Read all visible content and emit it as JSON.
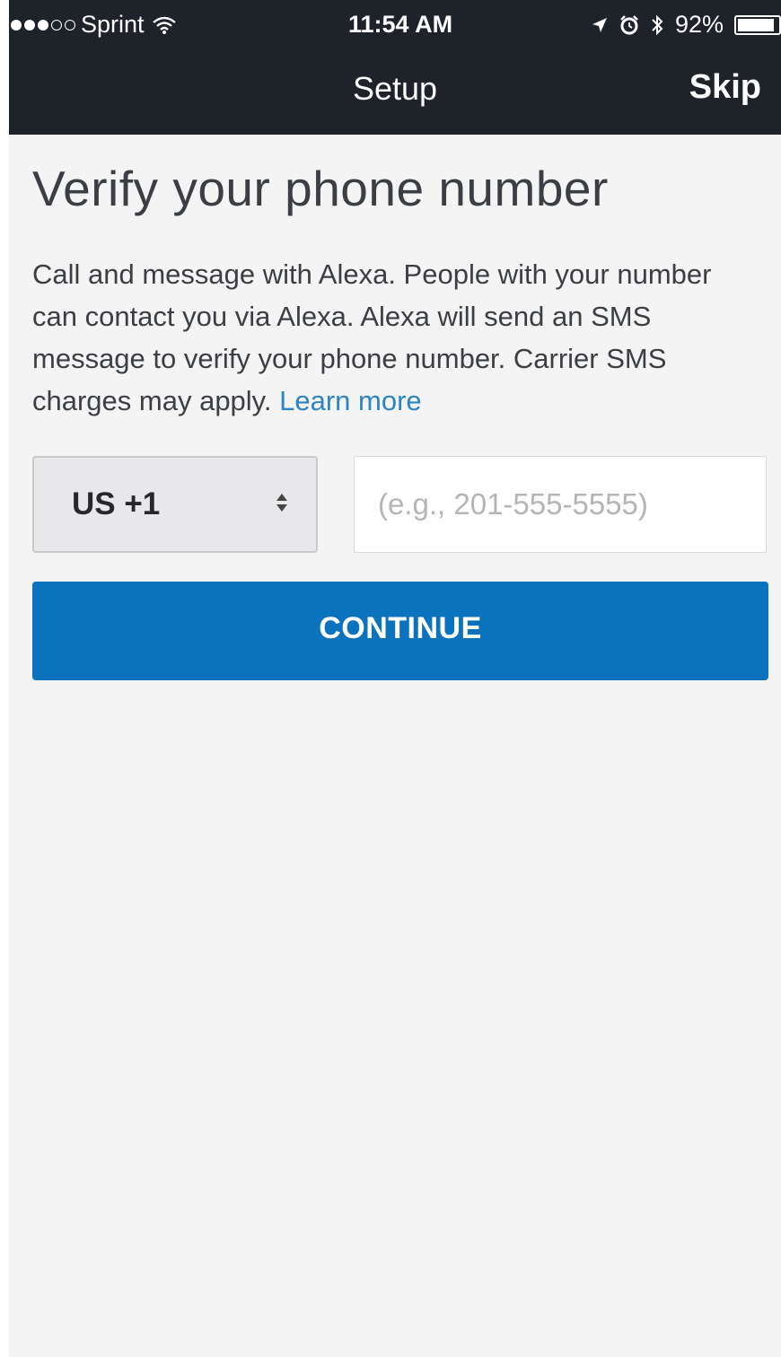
{
  "status_bar": {
    "carrier": "Sprint",
    "time": "11:54 AM",
    "battery_percent": "92%",
    "battery_level": 0.92,
    "signal_dots_filled": 3,
    "signal_dots_total": 5,
    "icons": [
      "wifi-icon",
      "location-icon",
      "alarm-icon",
      "bluetooth-icon",
      "battery-icon"
    ]
  },
  "nav": {
    "title": "Setup",
    "skip_label": "Skip"
  },
  "page": {
    "heading": "Verify your phone number",
    "description": "Call and message with Alexa. People with your number can contact you via Alexa. Alexa will send an SMS message to verify your phone number. Carrier SMS charges may apply.",
    "learn_more": "Learn more"
  },
  "form": {
    "country_code": "US +1",
    "phone_value": "",
    "phone_placeholder": "(e.g., 201-555-5555)",
    "continue_label": "CONTINUE"
  },
  "colors": {
    "nav_background": "#1e232a",
    "page_background": "#f4f4f5",
    "accent_button": "#0b72be",
    "link": "#2d84c4",
    "text": "#3b3f44"
  }
}
